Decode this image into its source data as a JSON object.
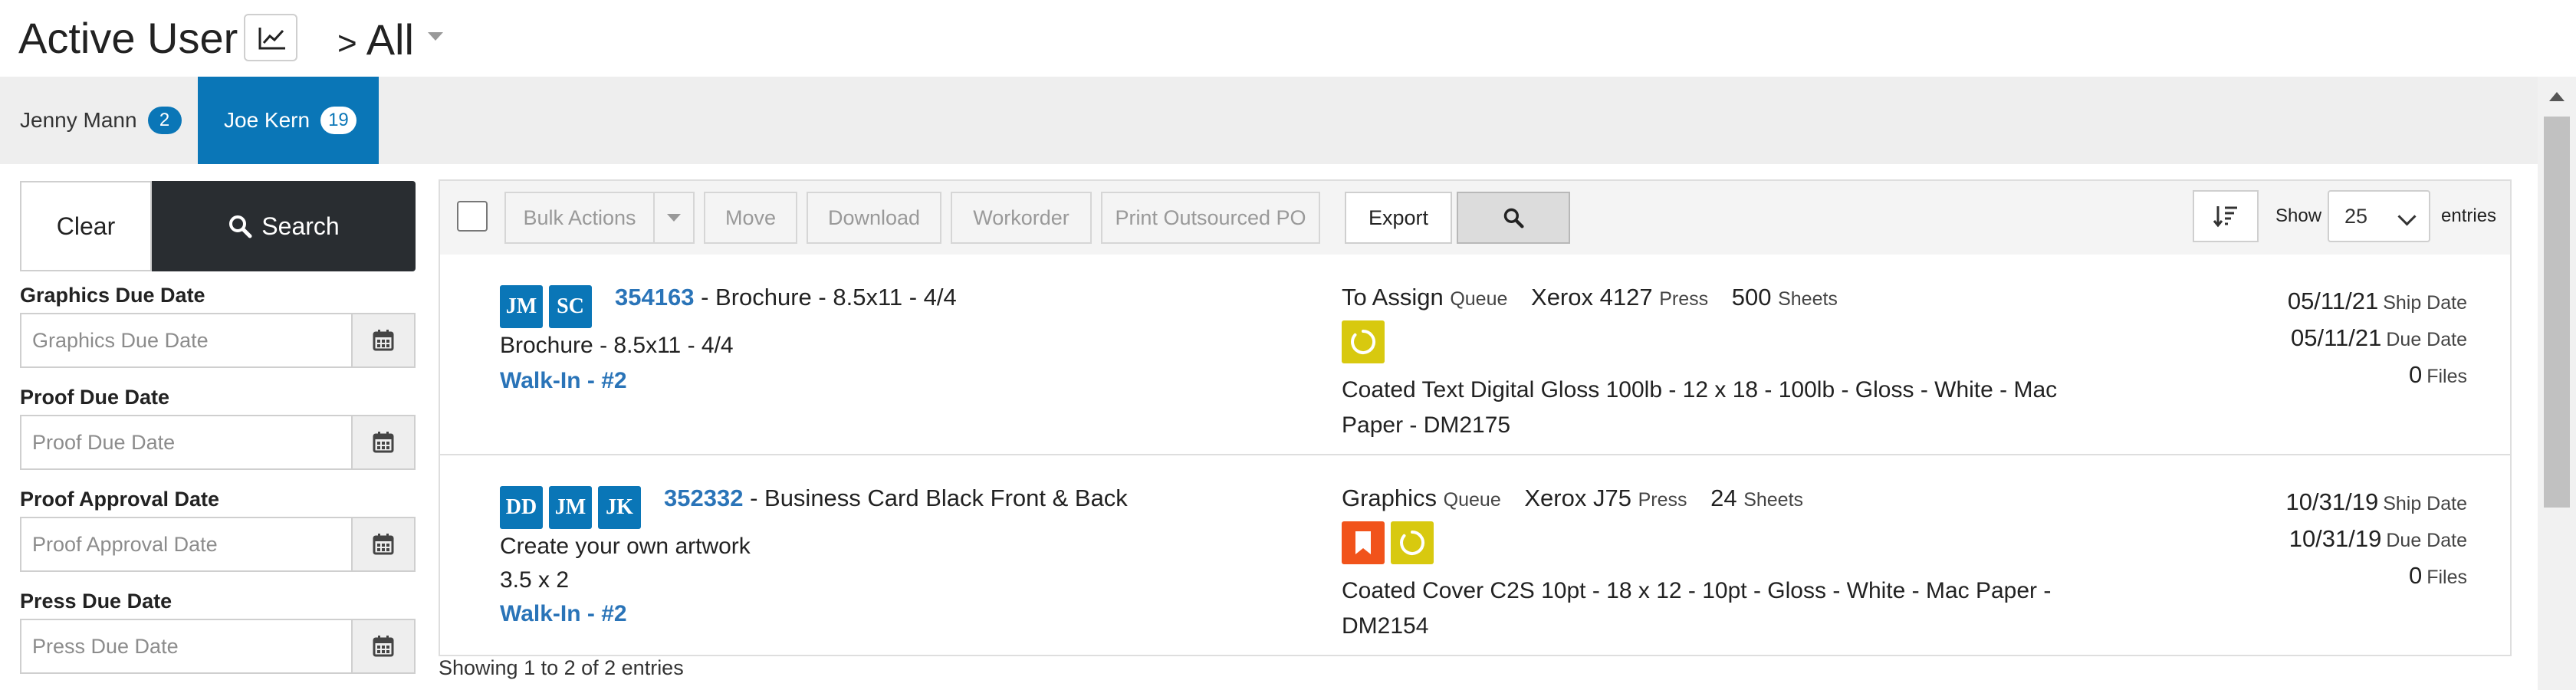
{
  "header": {
    "title": "Active User",
    "scope_prefix": ">",
    "scope": "All"
  },
  "user_tabs": [
    {
      "name": "Jenny Mann",
      "count": "2",
      "active": false
    },
    {
      "name": "Joe Kern",
      "count": "19",
      "active": true
    }
  ],
  "filters": {
    "clear_label": "Clear",
    "search_label": "Search",
    "fields": [
      {
        "label": "Graphics Due Date",
        "placeholder": "Graphics Due Date"
      },
      {
        "label": "Proof Due Date",
        "placeholder": "Proof Due Date"
      },
      {
        "label": "Proof Approval Date",
        "placeholder": "Proof Approval Date"
      },
      {
        "label": "Press Due Date",
        "placeholder": "Press Due Date"
      }
    ]
  },
  "toolbar": {
    "bulk_actions": "Bulk Actions",
    "move": "Move",
    "download": "Download",
    "workorder": "Workorder",
    "print_outsourced_po": "Print Outsourced PO",
    "export": "Export",
    "show_label": "Show",
    "page_size": "25",
    "entries_label": "entries"
  },
  "jobs": [
    {
      "initials": [
        "JM",
        "SC"
      ],
      "number": "354163",
      "title": "- Brochure - 8.5x11 - 4/4",
      "description": [
        "Brochure - 8.5x11 - 4/4"
      ],
      "customer": "Walk-In - #2",
      "queue": "To Assign",
      "queue_label": "Queue",
      "press": "Xerox 4127",
      "press_label": "Press",
      "sheets": "500",
      "sheets_label": "Sheets",
      "status_icons": [
        "progress-icon"
      ],
      "paper": "Coated Text Digital Gloss 100lb - 12 x 18 - 100lb - Gloss - White - Mac Paper - DM2175",
      "ship_date": "05/11/21",
      "ship_label": "Ship Date",
      "due_date": "05/11/21",
      "due_label": "Due Date",
      "files": "0",
      "files_label": "Files"
    },
    {
      "initials": [
        "DD",
        "JM",
        "JK"
      ],
      "number": "352332",
      "title": "- Business Card Black Front & Back",
      "description": [
        "Create your own artwork",
        "3.5 x 2"
      ],
      "customer": "Walk-In - #2",
      "queue": "Graphics",
      "queue_label": "Queue",
      "press": "Xerox J75",
      "press_label": "Press",
      "sheets": "24",
      "sheets_label": "Sheets",
      "status_icons": [
        "bookmark-icon",
        "progress-icon"
      ],
      "paper": "Coated Cover C2S 10pt - 18 x 12 - 10pt - Gloss - White - Mac Paper - DM2154",
      "ship_date": "10/31/19",
      "ship_label": "Ship Date",
      "due_date": "10/31/19",
      "due_label": "Due Date",
      "files": "0",
      "files_label": "Files"
    }
  ],
  "footer": {
    "info": "Showing 1 to 2 of 2 entries"
  },
  "colors": {
    "accent": "#0a76b7",
    "link": "#2a74b8",
    "dark_button": "#292d31",
    "status_yellow": "#d8c90f",
    "status_orange": "#f1531b"
  }
}
